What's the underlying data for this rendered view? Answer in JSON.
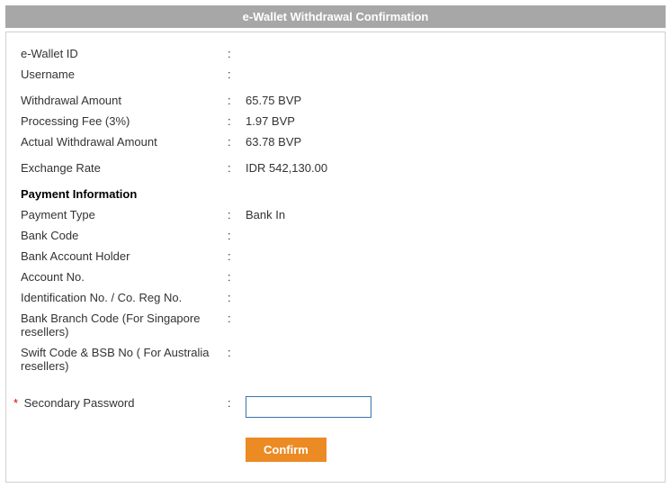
{
  "header_title": "e-Wallet Withdrawal Confirmation",
  "fields": {
    "ewallet_id": {
      "label": "e-Wallet ID",
      "value": ""
    },
    "username": {
      "label": "Username",
      "value": ""
    },
    "withdrawal_amount": {
      "label": "Withdrawal Amount",
      "value": "65.75 BVP"
    },
    "processing_fee": {
      "label": "Processing Fee (3%)",
      "value": "1.97 BVP"
    },
    "actual_withdrawal": {
      "label": "Actual Withdrawal Amount",
      "value": "63.78 BVP"
    },
    "exchange_rate": {
      "label": "Exchange Rate",
      "value": "IDR  542,130.00"
    }
  },
  "payment_section_title": "Payment Information",
  "payment": {
    "payment_type": {
      "label": "Payment Type",
      "value": "Bank In"
    },
    "bank_code": {
      "label": "Bank Code",
      "value": ""
    },
    "account_holder": {
      "label": "Bank Account Holder",
      "value": ""
    },
    "account_no": {
      "label": "Account No.",
      "value": ""
    },
    "id_no": {
      "label": "Identification No. / Co. Reg No.",
      "value": ""
    },
    "branch_code": {
      "label": "Bank Branch Code (For Singapore resellers)",
      "value": ""
    },
    "swift_code": {
      "label": "Swift Code & BSB No ( For Australia resellers)",
      "value": ""
    }
  },
  "secondary_password": {
    "label": "Secondary Password",
    "required_marker": "*",
    "value": ""
  },
  "confirm_label": "Confirm",
  "colon": ":"
}
